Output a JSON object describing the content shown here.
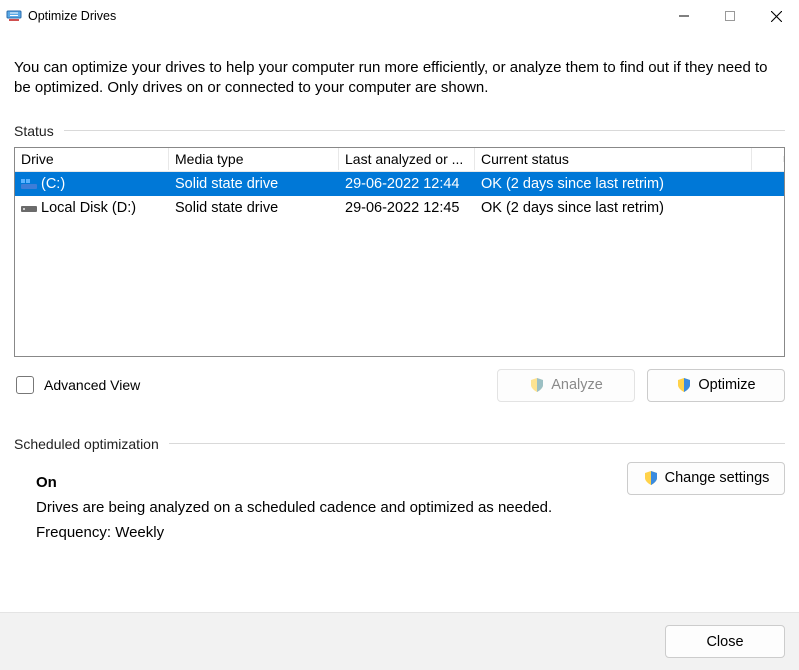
{
  "window": {
    "title": "Optimize Drives"
  },
  "description": "You can optimize your drives to help your computer run more efficiently, or analyze them to find out if they need to be optimized. Only drives on or connected to your computer are shown.",
  "status_section": {
    "label": "Status",
    "columns": {
      "drive": "Drive",
      "media": "Media type",
      "last": "Last analyzed or ...",
      "status": "Current status"
    },
    "rows": [
      {
        "name": "(C:)",
        "media": "Solid state drive",
        "last": "29-06-2022 12:44",
        "status": "OK (2 days since last retrim)",
        "selected": true,
        "icon": "drive-c-icon"
      },
      {
        "name": "Local Disk (D:)",
        "media": "Solid state drive",
        "last": "29-06-2022 12:45",
        "status": "OK (2 days since last retrim)",
        "selected": false,
        "icon": "drive-d-icon"
      }
    ]
  },
  "advanced_view_label": "Advanced View",
  "buttons": {
    "analyze": "Analyze",
    "optimize": "Optimize",
    "change_settings": "Change settings",
    "close": "Close"
  },
  "scheduled": {
    "label": "Scheduled optimization",
    "state": "On",
    "desc": "Drives are being analyzed on a scheduled cadence and optimized as needed.",
    "freq": "Frequency: Weekly"
  }
}
